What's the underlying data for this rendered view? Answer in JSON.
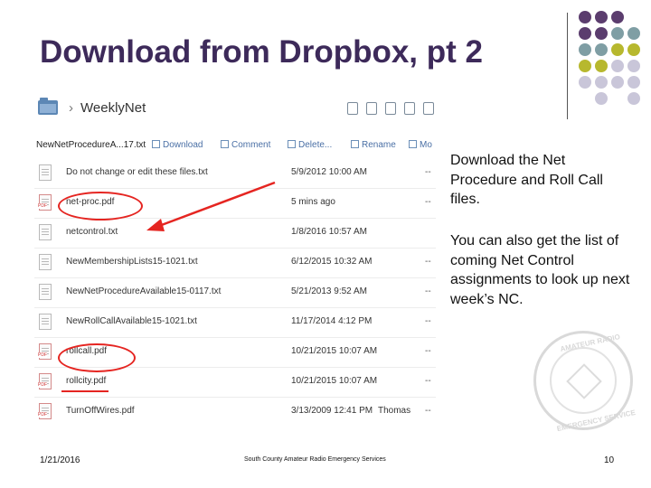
{
  "slide": {
    "title": "Download from Dropbox, pt 2",
    "bullets": [
      "Download the Net Procedure and Roll Call files.",
      "You can also get the list of coming Net Control assignments to look up next week’s NC."
    ],
    "footer": {
      "date": "1/21/2016",
      "org": "South County Amateur Radio Emergency Services",
      "page": "10"
    },
    "seal": {
      "top_text": "AMATEUR RADIO",
      "bottom_text": "EMERGENCY SERVICE"
    }
  },
  "dropbox": {
    "breadcrumb": {
      "sep": "›",
      "folder": "WeeklyNet"
    },
    "actionbar": {
      "file": "NewNetProcedureA...17.txt",
      "download": "Download",
      "comment": "Comment",
      "delete": "Delete...",
      "rename": "Rename",
      "more": "Mo"
    },
    "files": [
      {
        "name": "Do not change or edit these files.txt",
        "modified": "5/9/2012 10:00 AM",
        "extra": "",
        "dash": "--",
        "type": "txt"
      },
      {
        "name": "net-proc.pdf",
        "modified": "5 mins ago",
        "extra": "",
        "dash": "--",
        "type": "pdf"
      },
      {
        "name": "netcontrol.txt",
        "modified": "1/8/2016 10:57 AM",
        "extra": "",
        "dash": "",
        "type": "txt"
      },
      {
        "name": "NewMembershipLists15-1021.txt",
        "modified": "6/12/2015 10:32 AM",
        "extra": "",
        "dash": "--",
        "type": "txt"
      },
      {
        "name": "NewNetProcedureAvailable15-0117.txt",
        "modified": "5/21/2013 9:52 AM",
        "extra": "",
        "dash": "--",
        "type": "txt"
      },
      {
        "name": "NewRollCallAvailable15-1021.txt",
        "modified": "11/17/2014 4:12 PM",
        "extra": "",
        "dash": "--",
        "type": "txt"
      },
      {
        "name": "rollcall.pdf",
        "modified": "10/21/2015 10:07 AM",
        "extra": "",
        "dash": "--",
        "type": "pdf"
      },
      {
        "name": "rollcity.pdf",
        "modified": "10/21/2015 10:07 AM",
        "extra": "",
        "dash": "--",
        "type": "pdf"
      },
      {
        "name": "TurnOffWires.pdf",
        "modified": "3/13/2009 12:41 PM",
        "extra": "Thomas",
        "dash": "--",
        "type": "pdf"
      }
    ]
  },
  "colors": {
    "title": "#3d2a5a",
    "annotation_red": "#e52521",
    "dot_purple": "#5b3d6e",
    "dot_teal": "#7f9ea4",
    "dot_olive": "#b7b82e",
    "dot_lavender": "#c9c6d9"
  }
}
